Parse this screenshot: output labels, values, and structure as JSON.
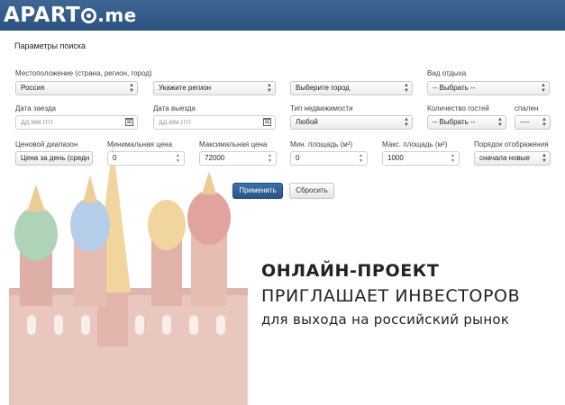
{
  "header": {
    "logo_left": "APART",
    "logo_right": ".me"
  },
  "form": {
    "title": "Параметры поиска",
    "location": {
      "label": "Местоположение (страна, регион, город)",
      "country": "Россия",
      "region": "Укажите регион",
      "city": "Выберите город"
    },
    "vacation_type": {
      "label": "Вид отдыха",
      "value": "-- Выбрать --"
    },
    "checkin": {
      "label": "Дата заезда",
      "placeholder": "дд.мм.гггг"
    },
    "checkout": {
      "label": "Дата выезда",
      "placeholder": "дд.мм.гггг"
    },
    "property_type": {
      "label": "Тип недвижимости",
      "value": "Любой"
    },
    "guests": {
      "label": "Количество гостей",
      "value": "-- Выбрать --"
    },
    "bedrooms": {
      "label": "спален",
      "value": "----"
    },
    "price_range": {
      "label": "Ценовой диапазон",
      "value": "Цена за день (средн"
    },
    "min_price": {
      "label": "Минимальная цена",
      "value": "0"
    },
    "max_price": {
      "label": "Максимальная цена",
      "value": "72000"
    },
    "min_area": {
      "label": "Мин. площадь (м²)",
      "value": "0"
    },
    "max_area": {
      "label": "Макс. площадь (м²)",
      "value": "1000"
    },
    "sort_order": {
      "label": "Порядок отображения",
      "value": "сначала новые"
    },
    "apply_label": "Применить",
    "reset_label": "Сбросить"
  },
  "promo": {
    "line1": "ОНЛАЙН-ПРОЕКТ",
    "line2": "ПРИГЛАШАЕТ ИНВЕСТОРОВ",
    "line3": "для выхода на российский рынок"
  },
  "colors": {
    "header": "#2f5a89",
    "primary_button": "#2f5f95"
  }
}
